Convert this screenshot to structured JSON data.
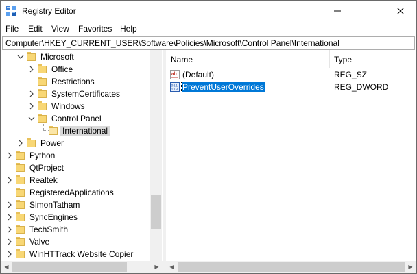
{
  "window": {
    "title": "Registry Editor",
    "icon": "registry-editor-icon"
  },
  "menu": [
    {
      "label": "File"
    },
    {
      "label": "Edit"
    },
    {
      "label": "View"
    },
    {
      "label": "Favorites"
    },
    {
      "label": "Help"
    }
  ],
  "address": {
    "path": "Computer\\HKEY_CURRENT_USER\\Software\\Policies\\Microsoft\\Control Panel\\International"
  },
  "tree": {
    "items": [
      {
        "label": "Microsoft",
        "expanded": true,
        "selected": false
      },
      {
        "label": "Office",
        "expanded": false,
        "selected": false
      },
      {
        "label": "Restrictions",
        "expanded": false,
        "selected": false
      },
      {
        "label": "SystemCertificates",
        "expanded": false,
        "selected": false
      },
      {
        "label": "Windows",
        "expanded": false,
        "selected": false
      },
      {
        "label": "Control Panel",
        "expanded": true,
        "selected": false
      },
      {
        "label": "International",
        "expanded": false,
        "selected": true
      },
      {
        "label": "Power",
        "expanded": false,
        "selected": false
      },
      {
        "label": "Python",
        "expanded": false,
        "selected": false
      },
      {
        "label": "QtProject",
        "expanded": false,
        "selected": false
      },
      {
        "label": "Realtek",
        "expanded": false,
        "selected": false
      },
      {
        "label": "RegisteredApplications",
        "expanded": false,
        "selected": false
      },
      {
        "label": "SimonTatham",
        "expanded": false,
        "selected": false
      },
      {
        "label": "SyncEngines",
        "expanded": false,
        "selected": false
      },
      {
        "label": "TechSmith",
        "expanded": false,
        "selected": false
      },
      {
        "label": "Valve",
        "expanded": false,
        "selected": false
      },
      {
        "label": "WinHTTrack Website Copier",
        "expanded": false,
        "selected": false
      }
    ]
  },
  "list": {
    "columns": [
      {
        "label": "Name"
      },
      {
        "label": "Type"
      }
    ],
    "rows": [
      {
        "name": "(Default)",
        "type": "REG_SZ",
        "icon": "string-value-icon",
        "selected": false
      },
      {
        "name": "PreventUserOverrides",
        "type": "REG_DWORD",
        "icon": "dword-value-icon",
        "selected": true
      }
    ]
  },
  "colors": {
    "selection": "#0078d7",
    "tree_selection": "#d9d9d9",
    "folder": "#f8d775",
    "string_icon": "#c0392b",
    "dword_icon": "#2a5db0"
  }
}
